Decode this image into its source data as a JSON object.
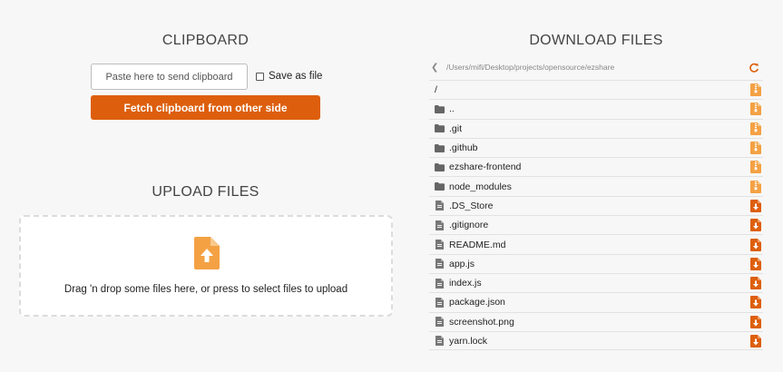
{
  "clipboard": {
    "title": "CLIPBOARD",
    "input_placeholder": "Paste here to send clipboard",
    "save_as_file_label": "Save as file",
    "fetch_button_label": "Fetch clipboard from other side"
  },
  "upload": {
    "title": "UPLOAD FILES",
    "dropzone_text": "Drag 'n drop some files here, or press to select files to upload",
    "icon": "upload-file-icon"
  },
  "download": {
    "title": "DOWNLOAD FILES",
    "current_path": "/Users/mifi/Desktop/projects/opensource/ezshare",
    "back_icon": "back-icon",
    "refresh_icon": "refresh-icon",
    "files": [
      {
        "name": "/",
        "type": "root",
        "action_icon": "zip-icon"
      },
      {
        "name": "..",
        "type": "dir",
        "action_icon": "zip-icon"
      },
      {
        "name": ".git",
        "type": "dir",
        "action_icon": "zip-icon"
      },
      {
        "name": ".github",
        "type": "dir",
        "action_icon": "zip-icon"
      },
      {
        "name": "ezshare-frontend",
        "type": "dir",
        "action_icon": "zip-icon"
      },
      {
        "name": "node_modules",
        "type": "dir",
        "action_icon": "zip-icon"
      },
      {
        "name": ".DS_Store",
        "type": "file",
        "action_icon": "download-icon"
      },
      {
        "name": ".gitignore",
        "type": "file",
        "action_icon": "download-icon"
      },
      {
        "name": "README.md",
        "type": "file",
        "action_icon": "download-icon"
      },
      {
        "name": "app.js",
        "type": "file",
        "action_icon": "download-icon"
      },
      {
        "name": "index.js",
        "type": "file",
        "action_icon": "download-icon"
      },
      {
        "name": "package.json",
        "type": "file",
        "action_icon": "download-icon"
      },
      {
        "name": "screenshot.png",
        "type": "file",
        "action_icon": "download-icon"
      },
      {
        "name": "yarn.lock",
        "type": "file",
        "action_icon": "download-icon"
      }
    ]
  },
  "colors": {
    "accent": "#dd5f0d",
    "accent_light": "#f4a144",
    "background": "#f7f7f7"
  }
}
